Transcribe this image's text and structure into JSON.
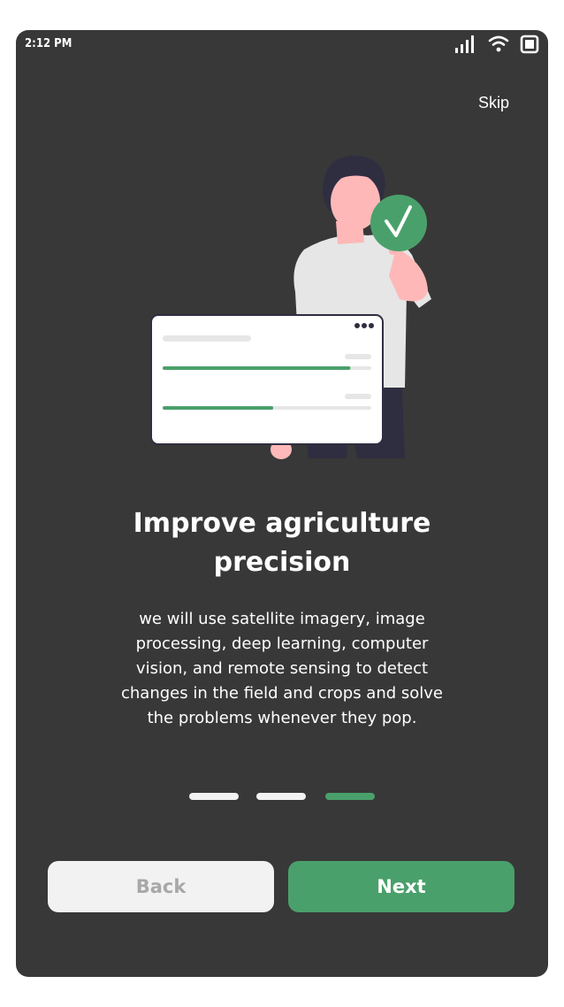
{
  "status_bar": {
    "time": "2:12 PM",
    "icons": [
      "signal-icon",
      "wifi-icon",
      "battery-icon"
    ]
  },
  "header": {
    "skip_label": "Skip"
  },
  "illustration": {
    "name": "person-with-checkmark-and-progress-card",
    "icons": [
      "checkmark-icon",
      "more-options-icon"
    ],
    "progress_values": [
      0.9,
      0.53
    ]
  },
  "content": {
    "title": "Improve agriculture precision",
    "title_line1": "Improve agriculture",
    "title_line2": "precision",
    "description_lines": [
      "we will use satellite imagery, image",
      "processing, deep learning, computer",
      "vision, and remote sensing to detect",
      "changes in the field and crops and solve",
      "the problems whenever they pop."
    ]
  },
  "pagination": {
    "total": 3,
    "active_index": 2
  },
  "buttons": {
    "back_label": "Back",
    "next_label": "Next"
  },
  "colors": {
    "background": "#383838",
    "accent": "#4aa06b",
    "light": "#f2f2f2",
    "disabled_text": "#a8a8a8"
  }
}
